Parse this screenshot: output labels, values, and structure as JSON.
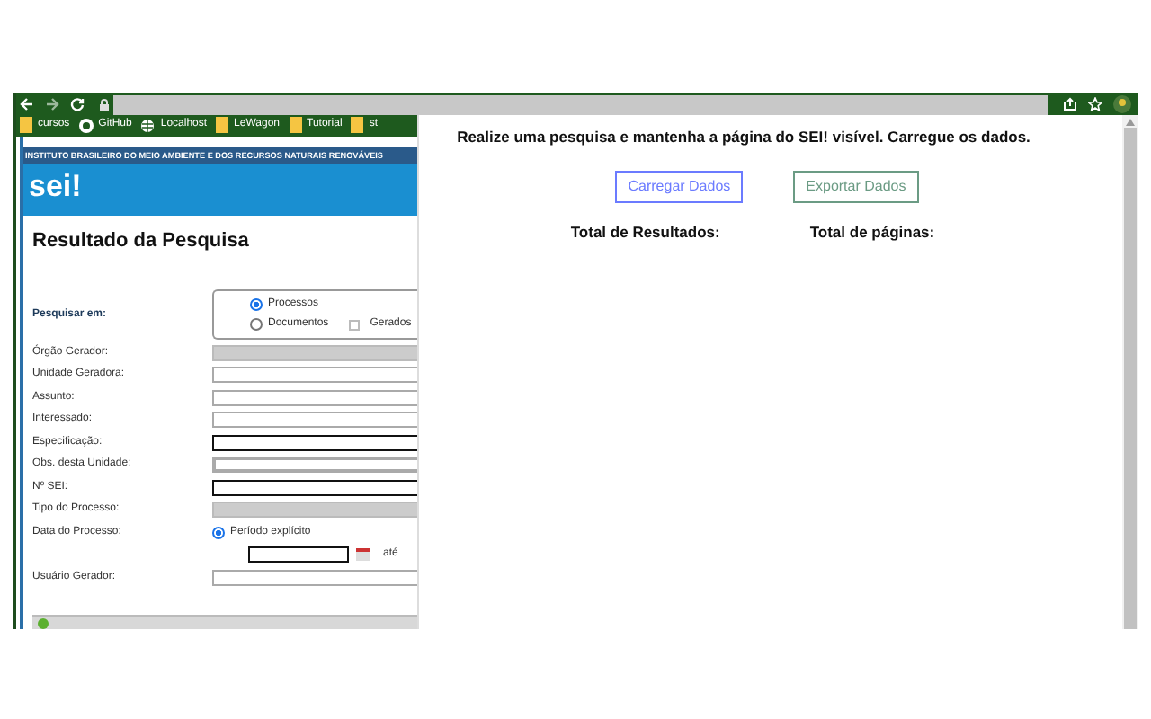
{
  "browser": {
    "bookmarks": [
      {
        "label": "cursos",
        "kind": "folder"
      },
      {
        "label": "GitHub",
        "kind": "github"
      },
      {
        "label": "Localhost",
        "kind": "globe"
      },
      {
        "label": "LeWagon",
        "kind": "folder"
      },
      {
        "label": "Tutorial",
        "kind": "folder"
      },
      {
        "label": "st",
        "kind": "folder"
      }
    ]
  },
  "sei_page": {
    "banner": "INSTITUTO BRASILEIRO DO MEIO AMBIENTE E DOS RECURSOS NATURAIS RENOVÁVEIS",
    "logo": "sei!",
    "title": "Resultado da Pesquisa",
    "search_in": {
      "label": "Pesquisar em:",
      "options": [
        {
          "label": "Processos",
          "selected": true
        },
        {
          "label": "Documentos",
          "selected": false
        }
      ],
      "checkbox": {
        "label": "Gerados",
        "checked": false
      }
    },
    "fields": [
      {
        "label": "Órgão Gerador:",
        "kind": "dropdown"
      },
      {
        "label": "Unidade Geradora:",
        "kind": "input"
      },
      {
        "label": "Assunto:",
        "kind": "input"
      },
      {
        "label": "Interessado:",
        "kind": "input"
      },
      {
        "label": "Especificação:",
        "kind": "outlined"
      },
      {
        "label": "Obs. desta Unidade:",
        "kind": "shaded"
      },
      {
        "label": "Nº SEI:",
        "kind": "outlined"
      },
      {
        "label": "Tipo do Processo:",
        "kind": "dropdown"
      }
    ],
    "date": {
      "label": "Data do Processo:",
      "option": {
        "label": "Período explícito",
        "selected": true
      },
      "until": "até"
    },
    "user": {
      "label": "Usuário Gerador:"
    }
  },
  "popup": {
    "message": "Realize uma pesquisa e mantenha a página do SEI! visível. Carregue os dados.",
    "buttons": [
      {
        "label": "Carregar Dados",
        "color": "#6b7bff"
      },
      {
        "label": "Exportar Dados",
        "color": "#6b9b84"
      }
    ],
    "totals": [
      "Total de Resultados:",
      "Total de páginas:"
    ]
  }
}
